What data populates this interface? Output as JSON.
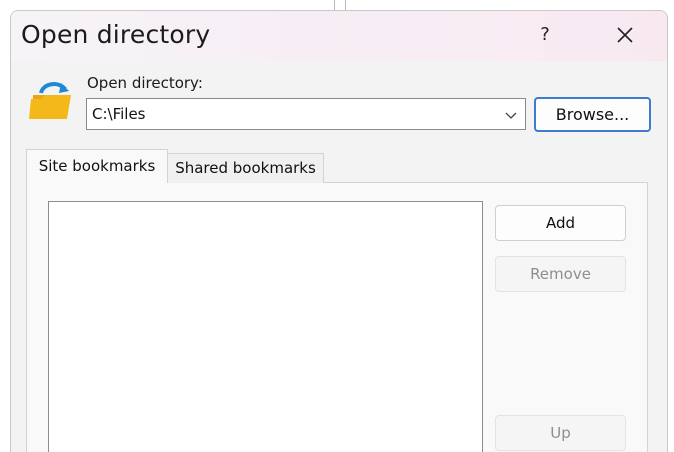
{
  "dialog": {
    "title": "Open directory",
    "help_label": "?",
    "close_icon": "close-icon"
  },
  "directory": {
    "label": "Open directory:",
    "value": "C:\\Files",
    "icon": "folder-open-icon",
    "browse_label": "Browse..."
  },
  "tabs": [
    {
      "label": "Site bookmarks",
      "selected": true
    },
    {
      "label": "Shared bookmarks",
      "selected": false
    }
  ],
  "bookmarks": {
    "items": [],
    "add_label": "Add",
    "remove_label": "Remove",
    "up_label": "Up",
    "remove_enabled": false,
    "up_enabled": false
  },
  "colors": {
    "accent": "#3c7bd0",
    "disabled_text": "#8e8e8e",
    "folder": "#f4b81a",
    "folder_arrow": "#1e88d8"
  }
}
